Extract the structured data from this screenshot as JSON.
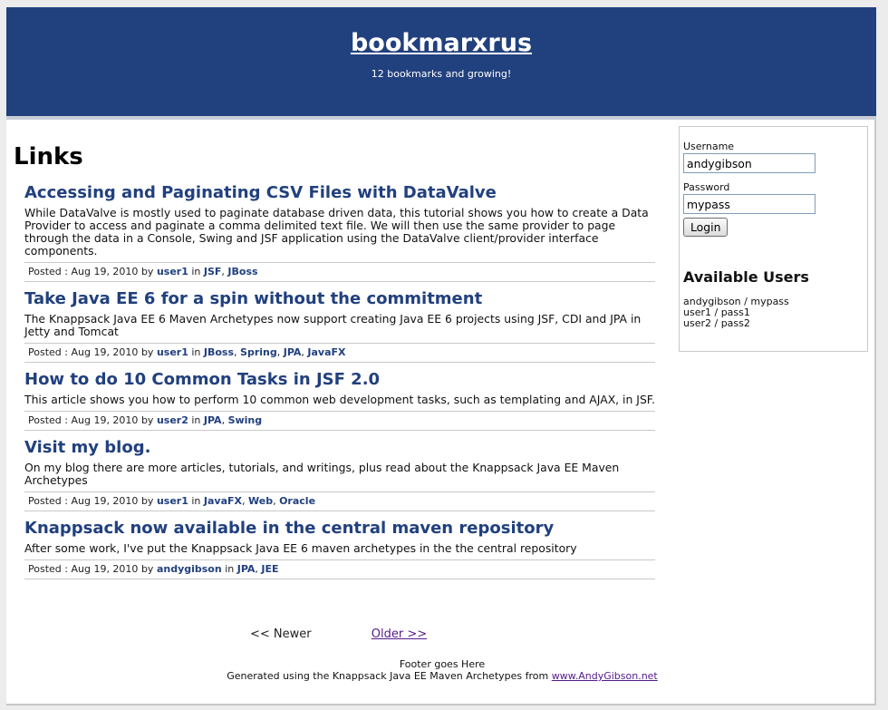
{
  "header": {
    "title": "bookmarxrus",
    "tagline": "12 bookmarks and growing!"
  },
  "main": {
    "page_title": "Links",
    "articles": [
      {
        "title": "Accessing and Paginating CSV Files with DataValve",
        "description": "While DataValve is mostly used to paginate database driven data, this tutorial shows you how to create a Data Provider to access and paginate a comma delimited text file. We will then use the same provider to page through the data in a Console, Swing and JSF application using the DataValve client/provider interface components.",
        "posted_label": "Posted :",
        "date": "Aug 19, 2010",
        "by": "by",
        "user": "user1",
        "in": "in",
        "tags": [
          "JSF",
          "JBoss"
        ]
      },
      {
        "title": "Take Java EE 6 for a spin without the commitment",
        "description": "The Knappsack Java EE 6 Maven Archetypes now support creating Java EE 6 projects using JSF, CDI and JPA in Jetty and Tomcat",
        "posted_label": "Posted :",
        "date": "Aug 19, 2010",
        "by": "by",
        "user": "user1",
        "in": "in",
        "tags": [
          "JBoss",
          "Spring",
          "JPA",
          "JavaFX"
        ]
      },
      {
        "title": "How to do 10 Common Tasks in JSF 2.0",
        "description": "This article shows you how to perform 10 common web development tasks, such as templating and AJAX, in JSF.",
        "posted_label": "Posted :",
        "date": "Aug 19, 2010",
        "by": "by",
        "user": "user2",
        "in": "in",
        "tags": [
          "JPA",
          "Swing"
        ]
      },
      {
        "title": "Visit my blog.",
        "description": "On my blog there are more articles, tutorials, and writings, plus read about the Knappsack Java EE Maven Archetypes",
        "posted_label": "Posted :",
        "date": "Aug 19, 2010",
        "by": "by",
        "user": "user1",
        "in": "in",
        "tags": [
          "JavaFX",
          "Web",
          "Oracle"
        ]
      },
      {
        "title": "Knappsack now available in the central maven repository",
        "description": "After some work, I've put the Knappsack Java EE 6 maven archetypes in the the central repository",
        "posted_label": "Posted :",
        "date": "Aug 19, 2010",
        "by": "by",
        "user": "andygibson",
        "in": "in",
        "tags": [
          "JPA",
          "JEE"
        ]
      }
    ],
    "pager": {
      "newer": "<< Newer",
      "older": "Older >>"
    }
  },
  "footer": {
    "line1": "Footer goes Here",
    "line2": "Generated using the Knappsack Java EE Maven Archetypes from",
    "link": "www.AndyGibson.net"
  },
  "sidebar": {
    "username_label": "Username",
    "username_value": "andygibson",
    "password_label": "Password",
    "password_value": "mypass",
    "login_label": "Login",
    "available_title": "Available Users",
    "users": [
      "andygibson / mypass",
      "user1 / pass1",
      "user2 / pass2"
    ]
  },
  "colors": {
    "header_bg": "#21407e",
    "link_blue": "#21407e",
    "visited_link": "#551a8b"
  }
}
